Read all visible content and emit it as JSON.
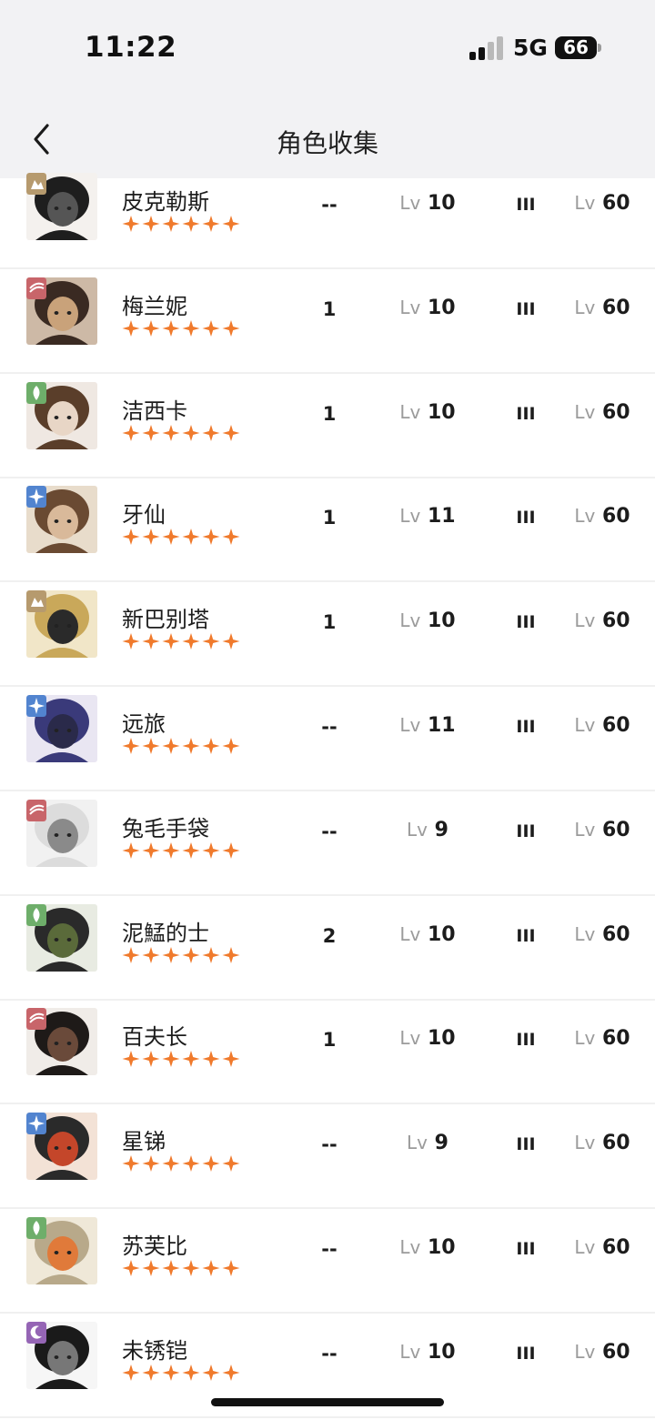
{
  "status_bar": {
    "time": "11:22",
    "network": "5G",
    "battery": "66"
  },
  "header": {
    "title": "角色收集",
    "back_icon": "chevron-left-icon"
  },
  "colors": {
    "star": "#f07a2c",
    "level_prefix": "#9b9b9b",
    "header_bg": "#f2f2f4",
    "row_divider": "#f0f0f0"
  },
  "level_prefix": "Lv",
  "star_count": 6,
  "characters": [
    {
      "name": "皮克勒斯",
      "count": "--",
      "level": "10",
      "rank": "III",
      "max_level": "60",
      "affinity": "mineral",
      "badge_color": "#b69a6e"
    },
    {
      "name": "梅兰妮",
      "count": "1",
      "level": "10",
      "rank": "III",
      "max_level": "60",
      "affinity": "beast",
      "badge_color": "#c8656a"
    },
    {
      "name": "洁西卡",
      "count": "1",
      "level": "10",
      "rank": "III",
      "max_level": "60",
      "affinity": "plant",
      "badge_color": "#6eae6a"
    },
    {
      "name": "牙仙",
      "count": "1",
      "level": "11",
      "rank": "III",
      "max_level": "60",
      "affinity": "star",
      "badge_color": "#5284cf"
    },
    {
      "name": "新巴别塔",
      "count": "1",
      "level": "10",
      "rank": "III",
      "max_level": "60",
      "affinity": "mineral",
      "badge_color": "#b69a6e"
    },
    {
      "name": "远旅",
      "count": "--",
      "level": "11",
      "rank": "III",
      "max_level": "60",
      "affinity": "star",
      "badge_color": "#5284cf"
    },
    {
      "name": "兔毛手袋",
      "count": "--",
      "level": "9",
      "rank": "III",
      "max_level": "60",
      "affinity": "beast",
      "badge_color": "#c8656a"
    },
    {
      "name": "泥鯭的士",
      "count": "2",
      "level": "10",
      "rank": "III",
      "max_level": "60",
      "affinity": "plant",
      "badge_color": "#6eae6a"
    },
    {
      "name": "百夫长",
      "count": "1",
      "level": "10",
      "rank": "III",
      "max_level": "60",
      "affinity": "beast",
      "badge_color": "#c8656a"
    },
    {
      "name": "星锑",
      "count": "--",
      "level": "9",
      "rank": "III",
      "max_level": "60",
      "affinity": "star",
      "badge_color": "#5284cf"
    },
    {
      "name": "苏芙比",
      "count": "--",
      "level": "10",
      "rank": "III",
      "max_level": "60",
      "affinity": "plant",
      "badge_color": "#6eae6a"
    },
    {
      "name": "未锈铠",
      "count": "--",
      "level": "10",
      "rank": "III",
      "max_level": "60",
      "affinity": "spirit",
      "badge_color": "#9565b5"
    }
  ]
}
